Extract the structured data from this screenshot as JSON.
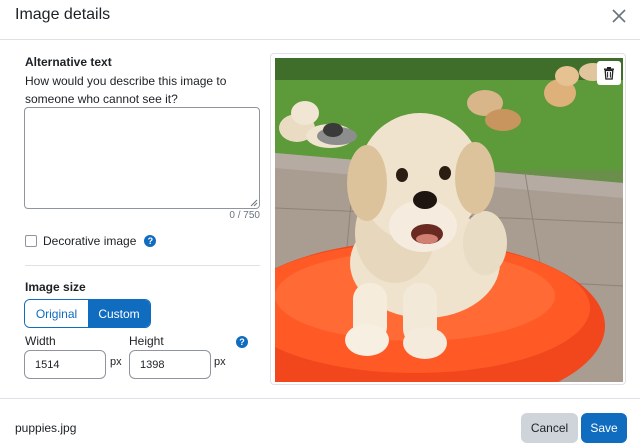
{
  "dialog": {
    "title": "Image details"
  },
  "alt_text": {
    "label": "Alternative text",
    "help": "How would you describe this image to someone who cannot see it?",
    "value": "",
    "char_count": "0 / 750"
  },
  "decorative": {
    "label": "Decorative image",
    "checked": false,
    "help_glyph": "?"
  },
  "image_size": {
    "label": "Image size",
    "options": [
      "Original",
      "Custom"
    ],
    "selected": "Custom",
    "width_label": "Width",
    "height_label": "Height",
    "width_value": "1514",
    "height_value": "1398",
    "unit": "px",
    "help_glyph": "?"
  },
  "footer": {
    "filename": "puppies.jpg",
    "cancel_label": "Cancel",
    "save_label": "Save"
  },
  "icons": {
    "close": "close-icon",
    "delete": "trash-icon",
    "help": "question-circle-icon"
  },
  "colors": {
    "accent": "#0f6cbf",
    "cancel_bg": "#ced4da",
    "border": "#dee2e6"
  }
}
